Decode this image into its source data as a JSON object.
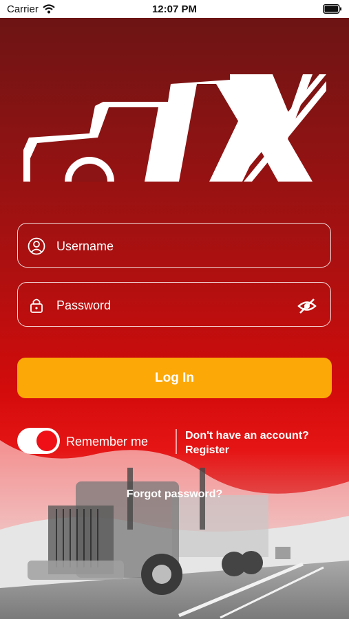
{
  "status_bar": {
    "carrier": "Carrier",
    "time": "12:07 PM"
  },
  "logo": {
    "text": "TX"
  },
  "username": {
    "placeholder": "Username"
  },
  "password": {
    "placeholder": "Password"
  },
  "login": {
    "label": "Log In"
  },
  "remember": {
    "label": "Remember me",
    "enabled": true
  },
  "register": {
    "line1": "Don't have an account?",
    "line2": "Register"
  },
  "forgot": {
    "label": "Forgot password?"
  },
  "colors": {
    "primary_red": "#ee0f17",
    "button": "#fca806",
    "bg_dark": "#6d1414"
  }
}
